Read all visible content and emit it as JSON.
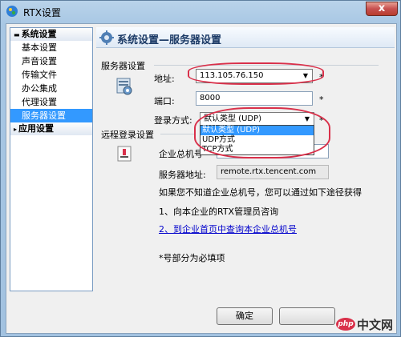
{
  "window": {
    "title": "RTX设置",
    "close_label": "x"
  },
  "nav": {
    "groups": [
      {
        "label": "系统设置",
        "items": [
          "基本设置",
          "声音设置",
          "传输文件",
          "办公集成",
          "代理设置",
          "服务器设置"
        ]
      },
      {
        "label": "应用设置"
      }
    ],
    "selected": "服务器设置"
  },
  "panel": {
    "title": "系统设置—服务器设置",
    "server_group": {
      "label": "服务器设置",
      "address_label": "地址:",
      "address_value": "113.105.76.150",
      "port_label": "端口:",
      "port_value": "8000",
      "login_label": "登录方式:",
      "login_value": "默认类型 (UDP)",
      "login_options": [
        "默认类型 (UDP)",
        "UDP方式",
        "TCP方式"
      ],
      "required_mark": "*"
    },
    "remote_group": {
      "label": "远程登录设置",
      "company_label": "企业总机号",
      "company_value": "",
      "server_label": "服务器地址:",
      "server_value": "remote.rtx.tencent.com",
      "info": "如果您不知道企业总机号，您可以通过如下途径获得",
      "step1": "1、向本企业的RTX管理员咨询",
      "step2": "2、到企业首页中查询本企业总机号",
      "note": "*号部分为必填项"
    },
    "ok_label": "确定"
  },
  "watermark": {
    "logo": "php",
    "text": "中文网"
  }
}
